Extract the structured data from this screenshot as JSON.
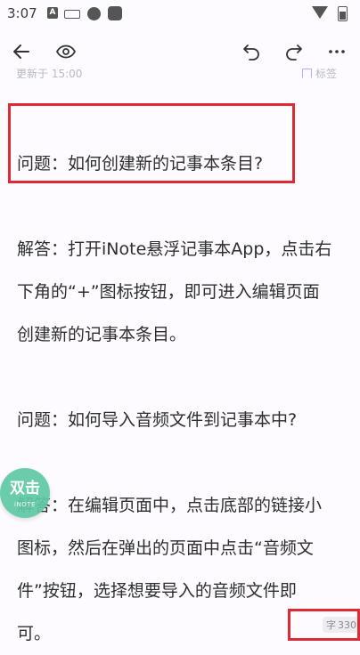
{
  "status_bar": {
    "time": "3:07",
    "icons": [
      "notification-a-icon",
      "keyboard-icon",
      "circle-icon",
      "square-icon",
      "wifi-icon",
      "battery-icon"
    ]
  },
  "toolbar": {
    "icons": [
      "back-arrow-icon",
      "eye-icon",
      "undo-icon",
      "redo-icon",
      "more-icon"
    ]
  },
  "meta": {
    "left_text": "更新于 15:00",
    "right_text": "标签"
  },
  "content": {
    "q1": "问题：如何创建新的记事本条目?",
    "a1_line1": "解答：打开iNote悬浮记事本App，点击右",
    "a1_line2": "下角的“+”图标按钮，即可进入编辑页面",
    "a1_line3": "创建新的记事本条目。",
    "q2": "问题：如何导入音频文件到记事本中?",
    "a2_line1": "解答：在编辑页面中，点击底部的链接小",
    "a2_line2": "图标，然后在弹出的页面中点击“音频文",
    "a2_line3": "件”按钮，选择想要导入的音频文件即",
    "a2_line4": "可。"
  },
  "char_count": "330",
  "floating_button": {
    "label": "双击",
    "brand": "iNOTE"
  },
  "colors": {
    "highlight": "#dd2b35",
    "float_bubble": "#5ec9a4",
    "background": "#fdfbff"
  }
}
